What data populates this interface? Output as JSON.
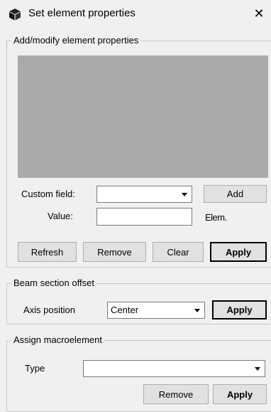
{
  "window": {
    "title": "Set element properties",
    "close_glyph": "✕",
    "icon": "cube-icon"
  },
  "element_props": {
    "legend": "Add/modify element properties",
    "custom_field_label": "Custom field:",
    "custom_field_value": "",
    "add_label": "Add",
    "value_label": "Value:",
    "value_value": "",
    "elem_label": "Elem.",
    "refresh_label": "Refresh",
    "remove_label": "Remove",
    "clear_label": "Clear",
    "apply_label": "Apply"
  },
  "beam_offset": {
    "legend": "Beam section offset",
    "axis_label": "Axis position",
    "axis_value": "Center",
    "apply_label": "Apply"
  },
  "macroelement": {
    "legend": "Assign macroelement",
    "type_label": "Type",
    "type_value": "",
    "remove_label": "Remove",
    "apply_label": "Apply"
  },
  "colors": {
    "panel_gray": "#aaaaaa",
    "window_bg": "#f0f0f0"
  }
}
